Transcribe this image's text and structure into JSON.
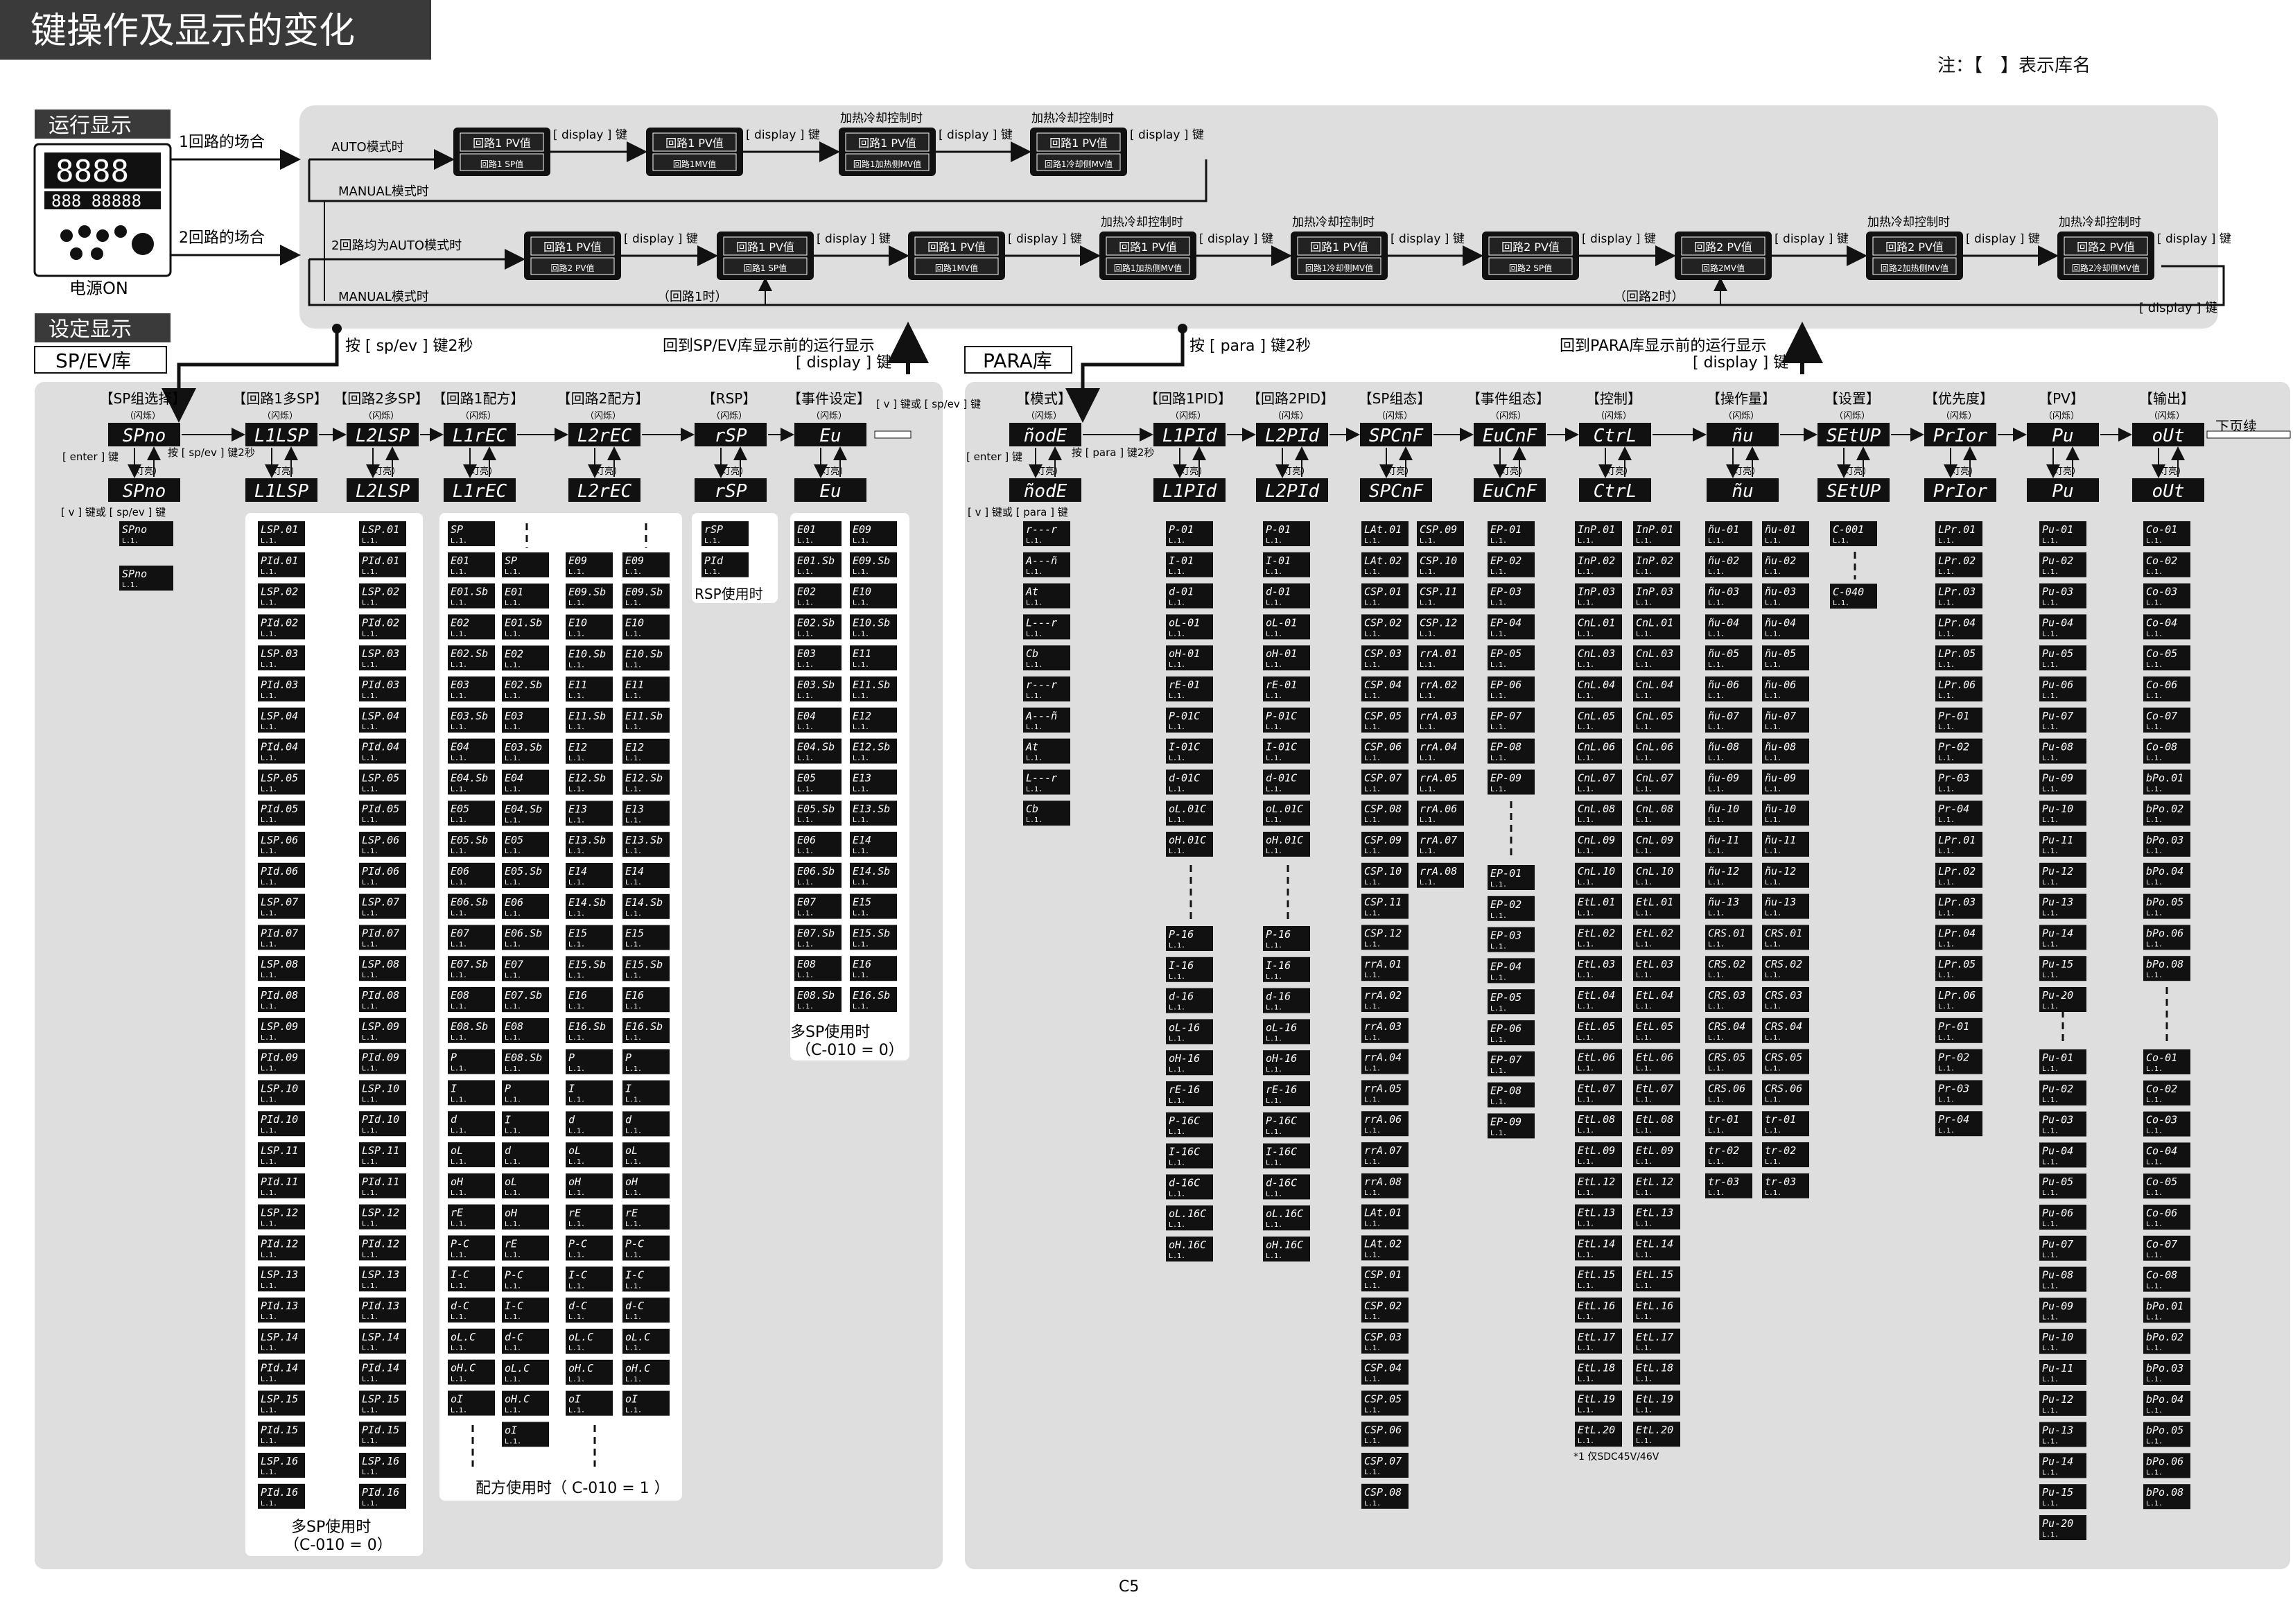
{
  "title": "键操作及显示的变化",
  "note": "注：【　】表示库名",
  "page_number": "C5",
  "run_display": {
    "label": "运行显示",
    "power_on": "电源ON",
    "one_loop": "1回路的场合",
    "two_loop": "2回路的场合",
    "auto_mode": "AUTO模式时",
    "manual_mode": "MANUAL模式时",
    "both_auto": "2回路均为AUTO模式时",
    "loop1_when": "（回路1时）",
    "loop2_when": "（回路2时）",
    "display_key": "[ display ] 键",
    "heat_cool": "加热冷却控制时",
    "row1": [
      {
        "top": "回路1 PV值",
        "bottom": "回路1 SP值"
      },
      {
        "top": "回路1 PV值",
        "bottom": "回路1MV值"
      },
      {
        "top": "回路1 PV值",
        "bottom": "回路1加热侧MV值"
      },
      {
        "top": "回路1 PV值",
        "bottom": "回路1冷却侧MV值"
      }
    ],
    "row2": [
      {
        "top": "回路1 PV值",
        "bottom": "回路2 PV值"
      },
      {
        "top": "回路1 PV值",
        "bottom": "回路1 SP值"
      },
      {
        "top": "回路1 PV值",
        "bottom": "回路1MV值"
      },
      {
        "top": "回路1 PV值",
        "bottom": "回路1加热侧MV值"
      },
      {
        "top": "回路1 PV值",
        "bottom": "回路1冷却侧MV值"
      },
      {
        "top": "回路2 PV值",
        "bottom": "回路2 SP值"
      },
      {
        "top": "回路2 PV值",
        "bottom": "回路2MV值"
      },
      {
        "top": "回路2 PV值",
        "bottom": "回路2加热侧MV值"
      },
      {
        "top": "回路2 PV值",
        "bottom": "回路2冷却侧MV值"
      }
    ]
  },
  "setting": {
    "label": "设定显示",
    "spev_bank": "SP/EV库",
    "para_bank": "PARA库",
    "press_spev": "按 [ sp/ev ] 键2秒",
    "press_para": "按 [ para ] 键2秒",
    "return_spev": "回到SP/EV库显示前的运行显示",
    "return_para": "回到PARA库显示前的运行显示",
    "display_key": "[ display ] 键",
    "blink": "（闪烁）",
    "lit": "（灯亮）",
    "enter_key": "[ enter ] 键",
    "v_or_spev": "[ v ] 键或 [ sp/ev ] 键",
    "v_or_para": "[ v ] 键或 [ para ] 键",
    "press_spev_short": "按 [ sp/ev ] 键2秒",
    "press_para_short": "按 [ para ] 键2秒",
    "next_page": "下页续",
    "footnote": "*1  仅SDC45V/46V",
    "rsp_use": "RSP使用时",
    "multi_sp_use": "多SP使用时",
    "multi_sp_cond": "（C-010 = 0）",
    "recipe_use": "配方使用时（ C-010 = 1 ）",
    "multisp_ev_use": "多SP使用时",
    "multisp_ev_cond": "（C-010 = 0）"
  },
  "spev_groups": [
    {
      "name": "【SP组选择】",
      "code": "SPno"
    },
    {
      "name": "【回路1多SP】",
      "code": "L1LSP"
    },
    {
      "name": "【回路2多SP】",
      "code": "L2LSP"
    },
    {
      "name": "【回路1配方】",
      "code": "L1rEC"
    },
    {
      "name": "【回路2配方】",
      "code": "L2rEC"
    },
    {
      "name": "【RSP】",
      "code": "rSP"
    },
    {
      "name": "【事件设定】",
      "code": "Eu"
    }
  ],
  "para_groups": [
    {
      "name": "【模式】",
      "code": "ñodE"
    },
    {
      "name": "【回路1PID】",
      "code": "L1PId"
    },
    {
      "name": "【回路2PID】",
      "code": "L2PId"
    },
    {
      "name": "【SP组态】",
      "code": "SPCnF"
    },
    {
      "name": "【事件组态】",
      "code": "EuCnF"
    },
    {
      "name": "【控制】",
      "code": "CtrL"
    },
    {
      "name": "【操作量】",
      "code": "ñu"
    },
    {
      "name": "【设置】",
      "code": "SEtUP"
    },
    {
      "name": "【优先度】",
      "code": "PrIor"
    },
    {
      "name": "【PV】",
      "code": "Pu"
    },
    {
      "name": "【输出】",
      "code": "oUt"
    }
  ],
  "lists": {
    "spno": [
      "SPno",
      "SPno"
    ],
    "l1lsp": [
      "LSP.01",
      "PId.01",
      "LSP.02",
      "PId.02",
      "LSP.03",
      "PId.03",
      "LSP.04",
      "PId.04",
      "LSP.05",
      "PId.05",
      "LSP.06",
      "PId.06",
      "LSP.07",
      "PId.07",
      "LSP.08",
      "PId.08",
      "LSP.09",
      "PId.09",
      "LSP.10",
      "PId.10",
      "LSP.11",
      "PId.11",
      "LSP.12",
      "PId.12",
      "LSP.13",
      "PId.13",
      "LSP.14",
      "PId.14",
      "LSP.15",
      "PId.15",
      "LSP.16",
      "PId.16"
    ],
    "recipe_a": [
      "SP",
      "E01",
      "E01.Sb",
      "E02",
      "E02.Sb",
      "E03",
      "E03.Sb",
      "E04",
      "E04.Sb",
      "E05",
      "E05.Sb",
      "E06",
      "E06.Sb",
      "E07",
      "E07.Sb",
      "E08",
      "E08.Sb",
      "P",
      "I",
      "d",
      "oL",
      "oH",
      "rE",
      "P-C",
      "I-C",
      "d-C",
      "oL.C",
      "oH.C",
      "oI"
    ],
    "recipe_b": [
      "E09",
      "E09.Sb",
      "E10",
      "E10.Sb",
      "E11",
      "E11.Sb",
      "E12",
      "E12.Sb",
      "E13",
      "E13.Sb",
      "E14",
      "E14.Sb",
      "E15",
      "E15.Sb",
      "E16",
      "E16.Sb",
      "P",
      "I",
      "d",
      "oL",
      "oH",
      "rE",
      "P-C",
      "I-C",
      "d-C",
      "oL.C",
      "oH.C",
      "oI"
    ],
    "rsp": [
      "rSP",
      "PId"
    ],
    "ev_a": [
      "E01",
      "E01.Sb",
      "E02",
      "E02.Sb",
      "E03",
      "E03.Sb",
      "E04",
      "E04.Sb",
      "E05",
      "E05.Sb",
      "E06",
      "E06.Sb",
      "E07",
      "E07.Sb",
      "E08",
      "E08.Sb"
    ],
    "ev_b": [
      "E09",
      "E09.Sb",
      "E10",
      "E10.Sb",
      "E11",
      "E11.Sb",
      "E12",
      "E12.Sb",
      "E13",
      "E13.Sb",
      "E14",
      "E14.Sb",
      "E15",
      "E15.Sb",
      "E16",
      "E16.Sb"
    ],
    "mode": [
      "r---r",
      "A---ñ",
      "At",
      "L---r",
      "Cb",
      "r---r",
      "A---ñ",
      "At",
      "L---r",
      "Cb"
    ],
    "pid_top": [
      "P-01",
      "I-01",
      "d-01",
      "oL-01",
      "oH-01",
      "rE-01",
      "P-01C",
      "I-01C",
      "d-01C",
      "oL.01C",
      "oH.01C"
    ],
    "pid_bot": [
      "P-16",
      "I-16",
      "d-16",
      "oL-16",
      "oH-16",
      "rE-16",
      "P-16C",
      "I-16C",
      "d-16C",
      "oL.16C",
      "oH.16C"
    ],
    "spcnf_a": [
      "LAt.01",
      "LAt.02",
      "CSP.01",
      "CSP.02",
      "CSP.03",
      "CSP.04",
      "CSP.05",
      "CSP.06",
      "CSP.07",
      "CSP.08",
      "CSP.09",
      "CSP.10",
      "CSP.11",
      "CSP.12",
      "rrA.01",
      "rrA.02",
      "rrA.03",
      "rrA.04",
      "rrA.05",
      "rrA.06",
      "rrA.07",
      "rrA.08",
      "LAt.01",
      "LAt.02",
      "CSP.01",
      "CSP.02",
      "CSP.03",
      "CSP.04",
      "CSP.05",
      "CSP.06",
      "CSP.07",
      "CSP.08"
    ],
    "spcnf_b": [
      "CSP.09",
      "CSP.10",
      "CSP.11",
      "CSP.12",
      "rrA.01",
      "rrA.02",
      "rrA.03",
      "rrA.04",
      "rrA.05",
      "rrA.06",
      "rrA.07",
      "rrA.08"
    ],
    "evcnf_top": [
      "EP-01",
      "EP-02",
      "EP-03",
      "EP-04",
      "EP-05",
      "EP-06",
      "EP-07",
      "EP-08",
      "EP-09"
    ],
    "evcnf_bot": [
      "EP-01",
      "EP-02",
      "EP-03",
      "EP-04",
      "EP-05",
      "EP-06",
      "EP-07",
      "EP-08",
      "EP-09"
    ],
    "ctrl_a": [
      "InP.01",
      "InP.02",
      "InP.03",
      "CnL.01",
      "CnL.03",
      "CnL.04",
      "CnL.05",
      "CnL.06",
      "CnL.07",
      "CnL.08",
      "CnL.09",
      "CnL.10",
      "EtL.01",
      "EtL.02",
      "EtL.03",
      "EtL.04",
      "EtL.05",
      "EtL.06",
      "EtL.07",
      "EtL.08",
      "EtL.09",
      "EtL.12",
      "EtL.13",
      "EtL.14",
      "EtL.15",
      "EtL.16",
      "EtL.17",
      "EtL.18",
      "EtL.19",
      "EtL.20"
    ],
    "ctrl_b": [
      "InP.01",
      "InP.02",
      "InP.03",
      "CnL.01",
      "CnL.03",
      "CnL.04",
      "CnL.05",
      "CnL.06",
      "CnL.07",
      "CnL.08",
      "CnL.09",
      "CnL.10",
      "EtL.01",
      "EtL.02",
      "EtL.03",
      "EtL.04",
      "EtL.05",
      "EtL.06",
      "EtL.07",
      "EtL.08",
      "EtL.09",
      "EtL.12",
      "EtL.13",
      "EtL.14",
      "EtL.15",
      "EtL.16",
      "EtL.17",
      "EtL.18",
      "EtL.19",
      "EtL.20"
    ],
    "mv_a": [
      "ñu-01",
      "ñu-02",
      "ñu-03",
      "ñu-04",
      "ñu-05",
      "ñu-06",
      "ñu-07",
      "ñu-08",
      "ñu-09",
      "ñu-10",
      "ñu-11",
      "ñu-12",
      "ñu-13",
      "CRS.01",
      "CRS.02",
      "CRS.03",
      "CRS.04",
      "CRS.05",
      "CRS.06",
      "tr-01",
      "tr-02",
      "tr-03"
    ],
    "mv_b": [
      "ñu-01",
      "ñu-02",
      "ñu-03",
      "ñu-04",
      "ñu-05",
      "ñu-06",
      "ñu-07",
      "ñu-08",
      "ñu-09",
      "ñu-10",
      "ñu-11",
      "ñu-12",
      "ñu-13",
      "CRS.01",
      "CRS.02",
      "CRS.03",
      "CRS.04",
      "CRS.05",
      "CRS.06",
      "tr-01",
      "tr-02",
      "tr-03"
    ],
    "setup": [
      "C-001",
      "C-040"
    ],
    "prio": [
      "LPr.01",
      "LPr.02",
      "LPr.03",
      "LPr.04",
      "LPr.05",
      "LPr.06",
      "Pr-01",
      "Pr-02",
      "Pr-03",
      "Pr-04",
      "LPr.01",
      "LPr.02",
      "LPr.03",
      "LPr.04",
      "LPr.05",
      "LPr.06",
      "Pr-01",
      "Pr-02",
      "Pr-03",
      "Pr-04"
    ],
    "pv_top": [
      "Pu-01",
      "Pu-02",
      "Pu-03",
      "Pu-04",
      "Pu-05",
      "Pu-06",
      "Pu-07",
      "Pu-08",
      "Pu-09",
      "Pu-10",
      "Pu-11",
      "Pu-12",
      "Pu-13",
      "Pu-14",
      "Pu-15",
      "Pu-20"
    ],
    "pv_bot": [
      "Pu-01",
      "Pu-02",
      "Pu-03",
      "Pu-04",
      "Pu-05",
      "Pu-06",
      "Pu-07",
      "Pu-08",
      "Pu-09",
      "Pu-10",
      "Pu-11",
      "Pu-12",
      "Pu-13",
      "Pu-14",
      "Pu-15",
      "Pu-20"
    ],
    "out_top": [
      "Co-01",
      "Co-02",
      "Co-03",
      "Co-04",
      "Co-05",
      "Co-06",
      "Co-07",
      "Co-08",
      "bPo.01",
      "bPo.02",
      "bPo.03",
      "bPo.04",
      "bPo.05",
      "bPo.06",
      "bPo.08"
    ],
    "out_bot": [
      "Co-01",
      "Co-02",
      "Co-03",
      "Co-04",
      "Co-05",
      "Co-06",
      "Co-07",
      "Co-08",
      "bPo.01",
      "bPo.02",
      "bPo.03",
      "bPo.04",
      "bPo.05",
      "bPo.06",
      "bPo.08"
    ]
  },
  "cell_sub": "L.1.",
  "colors": {
    "title_bg": "#3a3a3a",
    "panel": "#dedede",
    "cell": "#111111",
    "cell_text": "#ffffff"
  }
}
